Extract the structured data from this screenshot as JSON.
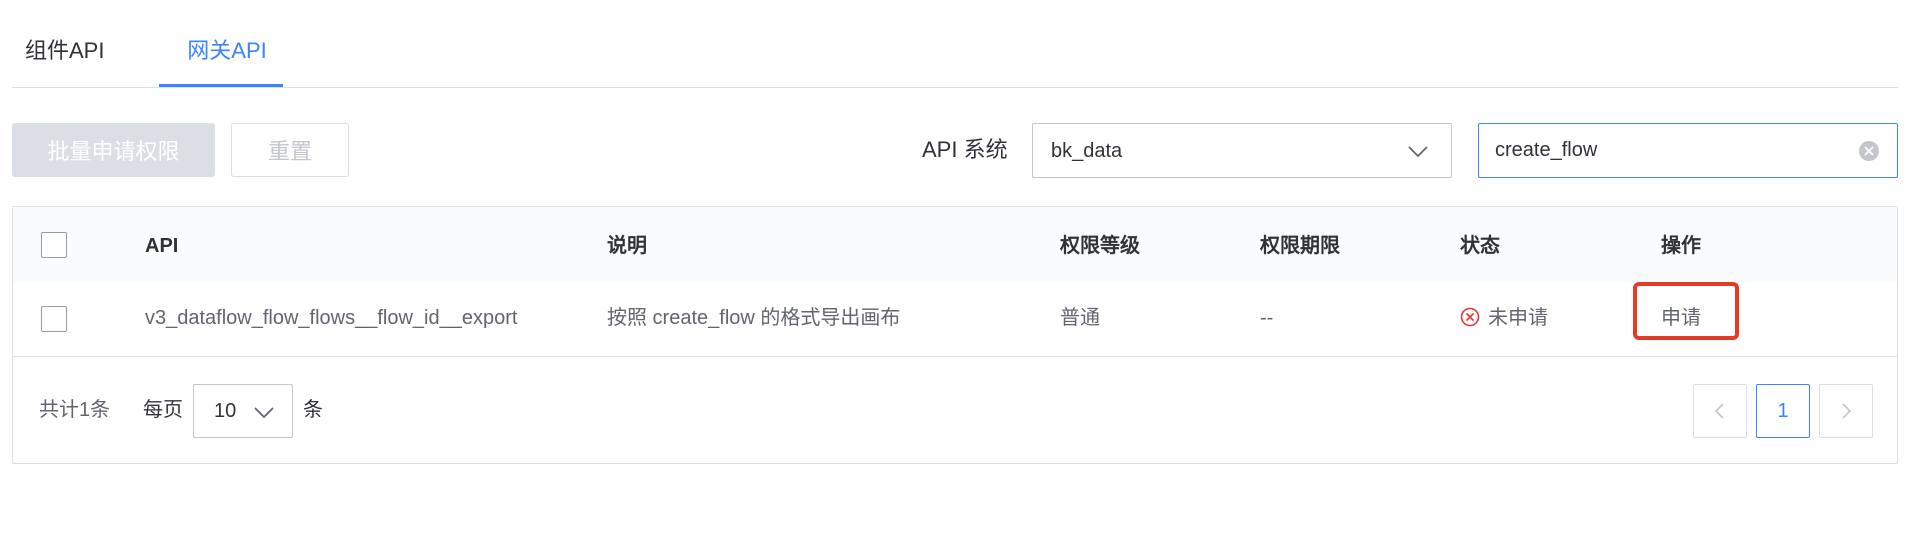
{
  "tabs": {
    "components": "组件API",
    "gateway": "网关API"
  },
  "toolbar": {
    "batch_apply_label": "批量申请权限",
    "reset_label": "重置"
  },
  "filters": {
    "system_label": "API 系统",
    "system_value": "bk_data",
    "search_value": "create_flow"
  },
  "table": {
    "headers": {
      "api": "API",
      "description": "说明",
      "level": "权限等级",
      "expiry": "权限期限",
      "status": "状态",
      "action": "操作"
    },
    "rows": [
      {
        "api": "v3_dataflow_flow_flows__flow_id__export",
        "description": "按照 create_flow 的格式导出画布",
        "level": "普通",
        "expiry": "--",
        "status": "未申请",
        "action": "申请"
      }
    ]
  },
  "pagination": {
    "total_text": "共计1条",
    "per_page_label": "每页",
    "page_size": "10",
    "unit_label": "条",
    "current_page": "1"
  },
  "colors": {
    "primary": "#3a84ff",
    "danger": "#ea3636",
    "highlight": "#e53b24",
    "border": "#dcdee5"
  },
  "icons": [
    "chevron-down-icon",
    "clear-icon",
    "close-circle-icon",
    "chevron-left-icon",
    "chevron-right-icon"
  ]
}
